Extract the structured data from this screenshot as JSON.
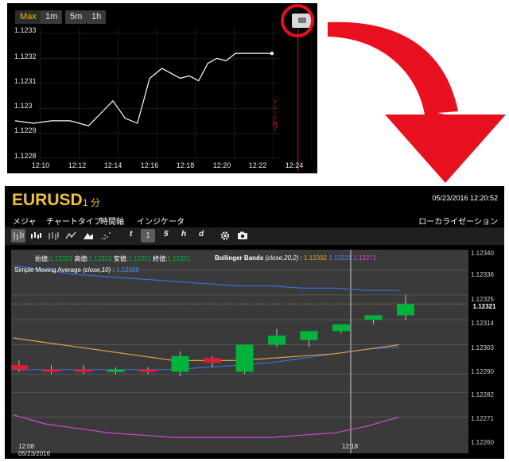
{
  "mini_chart": {
    "timeframes": [
      {
        "label": "Max",
        "active": true
      },
      {
        "label": "1m",
        "active": false
      },
      {
        "label": "5m",
        "active": false
      },
      {
        "label": "1h",
        "active": false
      }
    ],
    "y_labels": [
      "1.1233",
      "1.1232",
      "1.1231",
      "1.123",
      "1.1229",
      "1.1228"
    ],
    "x_labels": [
      "12:10",
      "12:12",
      "12:14",
      "12:16",
      "12:18",
      "12:20",
      "12:22",
      "12:24"
    ],
    "trade_end_label": "トレード終了",
    "chart_data": {
      "type": "line",
      "x": [
        "12:08:00",
        "12:09:00",
        "12:10:00",
        "12:11:00",
        "12:12:00",
        "12:12:40",
        "12:13:20",
        "12:14:00",
        "12:14:40",
        "12:15:20",
        "12:16:00",
        "12:16:30",
        "12:17:00",
        "12:17:30",
        "12:18:00",
        "12:18:30",
        "12:19:00",
        "12:19:30",
        "12:20:00",
        "12:21:00",
        "12:22:00"
      ],
      "values": [
        1.12295,
        1.12294,
        1.12295,
        1.12295,
        1.12293,
        1.12298,
        1.12303,
        1.12296,
        1.12294,
        1.12312,
        1.12316,
        1.12314,
        1.12312,
        1.12313,
        1.12311,
        1.12318,
        1.1232,
        1.12319,
        1.12322,
        1.12322,
        1.12322
      ],
      "ylim": [
        1.1228,
        1.1234
      ],
      "yticks": [
        1.1228,
        1.1229,
        1.123,
        1.1231,
        1.1232,
        1.1233
      ],
      "xticks": [
        "12:10",
        "12:12",
        "12:14",
        "12:16",
        "12:18",
        "12:20",
        "12:22",
        "12:24"
      ],
      "line_color": "#ffffff",
      "background": "#000000",
      "vertical_marker": "12:23"
    }
  },
  "main_chart": {
    "symbol": "EURUSD",
    "timeframe": "1 分",
    "datetime": "05/23/2016 12:20:52",
    "menu": [
      "メジャ",
      "チャートタイプ",
      "時間軸",
      "インジケータ"
    ],
    "locale_label": "ローカライゼーション",
    "toolbar": {
      "chart_type_icons": [
        "ohlc-bars-icon",
        "candles-icon",
        "hlc-bars-icon",
        "line-icon",
        "mountain-icon",
        "dots-icon"
      ],
      "periods": [
        {
          "label": "t",
          "selected": false
        },
        {
          "label": "1",
          "selected": true
        },
        {
          "label": "5",
          "selected": false
        },
        {
          "label": "h",
          "selected": false
        },
        {
          "label": "d",
          "selected": false
        }
      ]
    },
    "legend": {
      "ohlc_labels": [
        "始値:",
        "高値:",
        "安値:",
        "終値:"
      ],
      "ohlc_values": [
        "1.12321",
        "1.12323",
        "1.12321",
        "1.12321"
      ],
      "bb_label": "Bollinger Bands",
      "bb_params": "(close,20,2)",
      "bb_values": [
        "1.12302",
        "1.12321",
        "1.12271"
      ],
      "sma_label": "Simple Moving Average",
      "sma_params": "(close,10)",
      "sma_value": "1.12308"
    },
    "y_labels": [
      "1.12340",
      "1.12336",
      "1.12325",
      "1.12314",
      "1.12303",
      "1.12290",
      "1.12282",
      "1.12271",
      "1.12260"
    ],
    "last_price": "1.12321",
    "x_labels": [
      {
        "label": "12:08",
        "date": "05/23/2016"
      },
      {
        "label": "12:18",
        "date": ""
      }
    ],
    "colors": {
      "up": "#00b33a",
      "down": "#e01a30",
      "bb_upper": "#3a6fd8",
      "bb_middle": "#3a6fd8",
      "bb_lower": "#d04ad0",
      "sma": "#e0a040",
      "symbol": "#f0c23b"
    },
    "chart_data": {
      "type": "candlestick",
      "categories": [
        "12:08",
        "12:09",
        "12:10",
        "12:11",
        "12:12",
        "12:13",
        "12:14",
        "12:15",
        "12:16",
        "12:17",
        "12:18",
        "12:19",
        "12:20"
      ],
      "candles": [
        {
          "open": 1.12294,
          "high": 1.12296,
          "low": 1.12291,
          "close": 1.12292
        },
        {
          "open": 1.12292,
          "high": 1.12294,
          "low": 1.1229,
          "close": 1.12291
        },
        {
          "open": 1.12292,
          "high": 1.12294,
          "low": 1.1229,
          "close": 1.12291
        },
        {
          "open": 1.12291,
          "high": 1.12293,
          "low": 1.1229,
          "close": 1.12292
        },
        {
          "open": 1.12292,
          "high": 1.12293,
          "low": 1.1229,
          "close": 1.12291
        },
        {
          "open": 1.12291,
          "high": 1.123,
          "low": 1.12289,
          "close": 1.12298
        },
        {
          "open": 1.12297,
          "high": 1.12298,
          "low": 1.12293,
          "close": 1.12295
        },
        {
          "open": 1.12291,
          "high": 1.12303,
          "low": 1.1229,
          "close": 1.12303
        },
        {
          "open": 1.12303,
          "high": 1.1231,
          "low": 1.12302,
          "close": 1.12307
        },
        {
          "open": 1.12305,
          "high": 1.12309,
          "low": 1.12302,
          "close": 1.12309
        },
        {
          "open": 1.12309,
          "high": 1.12312,
          "low": 1.12308,
          "close": 1.12312
        },
        {
          "open": 1.12314,
          "high": 1.12316,
          "low": 1.12312,
          "close": 1.12316
        },
        {
          "open": 1.12316,
          "high": 1.12325,
          "low": 1.12314,
          "close": 1.12321
        }
      ],
      "bb_upper": [
        1.12338,
        1.12336,
        1.12334,
        1.12333,
        1.12332,
        1.12331,
        1.1233,
        1.12329,
        1.12329,
        1.12328,
        1.12328,
        1.12327,
        1.12327
      ],
      "bb_middle": [
        1.12292,
        1.12292,
        1.12292,
        1.12292,
        1.12292,
        1.12292,
        1.12293,
        1.12294,
        1.12295,
        1.12297,
        1.12299,
        1.12301,
        1.12302
      ],
      "bb_lower": [
        1.12272,
        1.12268,
        1.12266,
        1.12264,
        1.12263,
        1.12262,
        1.12262,
        1.12262,
        1.12262,
        1.12263,
        1.12264,
        1.12267,
        1.12271
      ],
      "sma": [
        1.12306,
        1.12304,
        1.12302,
        1.123,
        1.12298,
        1.12296,
        1.12296,
        1.12296,
        1.12297,
        1.12298,
        1.12299,
        1.12301,
        1.12303
      ],
      "ylim": [
        1.12255,
        1.12345
      ],
      "last_price_line": 1.12321
    }
  }
}
